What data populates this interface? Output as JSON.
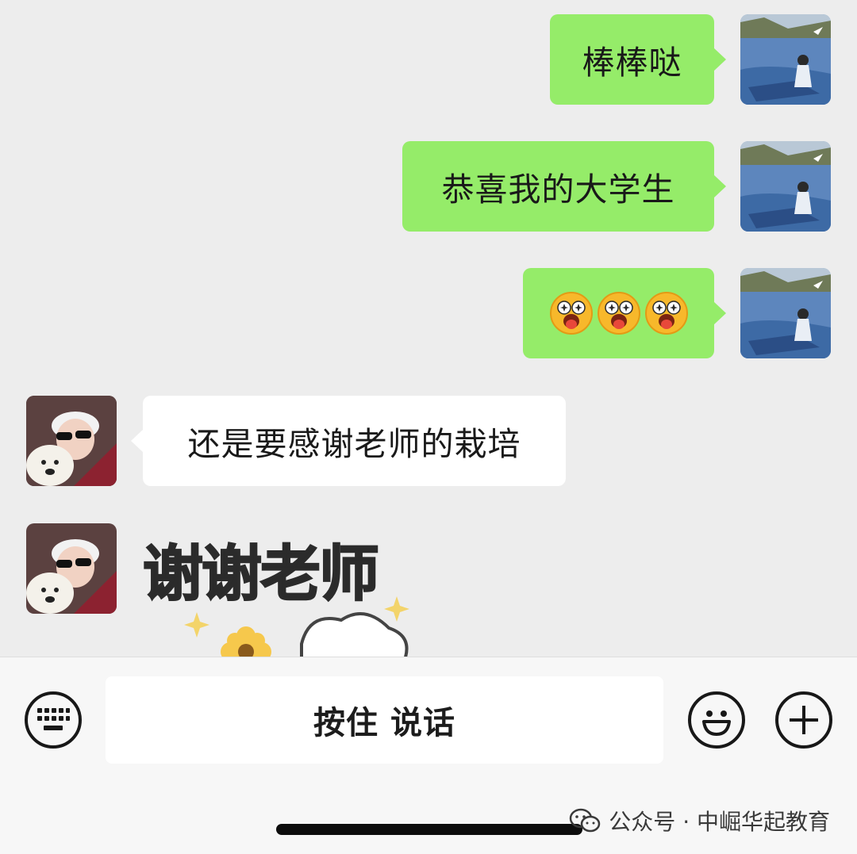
{
  "messages": [
    {
      "direction": "out",
      "text": "棒棒哒"
    },
    {
      "direction": "out",
      "text": "恭喜我的大学生"
    },
    {
      "direction": "out",
      "emoji": [
        "star-eyes-tongue-emoji",
        "star-eyes-tongue-emoji",
        "star-eyes-tongue-emoji"
      ]
    },
    {
      "direction": "in",
      "text": "还是要感谢老师的栽培"
    },
    {
      "direction": "in",
      "sticker_text": "谢谢老师"
    }
  ],
  "input_bar": {
    "voice_hold_label": "按住 说话",
    "keyboard_icon": "keyboard-icon",
    "emoji_icon": "smiley-icon",
    "plus_icon": "plus-icon"
  },
  "watermark": {
    "icon": "wechat-icon",
    "text": "公众号 · 中崛华起教育"
  },
  "colors": {
    "outgoing_bubble": "#95ec69",
    "incoming_bubble": "#ffffff",
    "chat_background": "#ededed",
    "input_bar_background": "#f7f7f7"
  }
}
